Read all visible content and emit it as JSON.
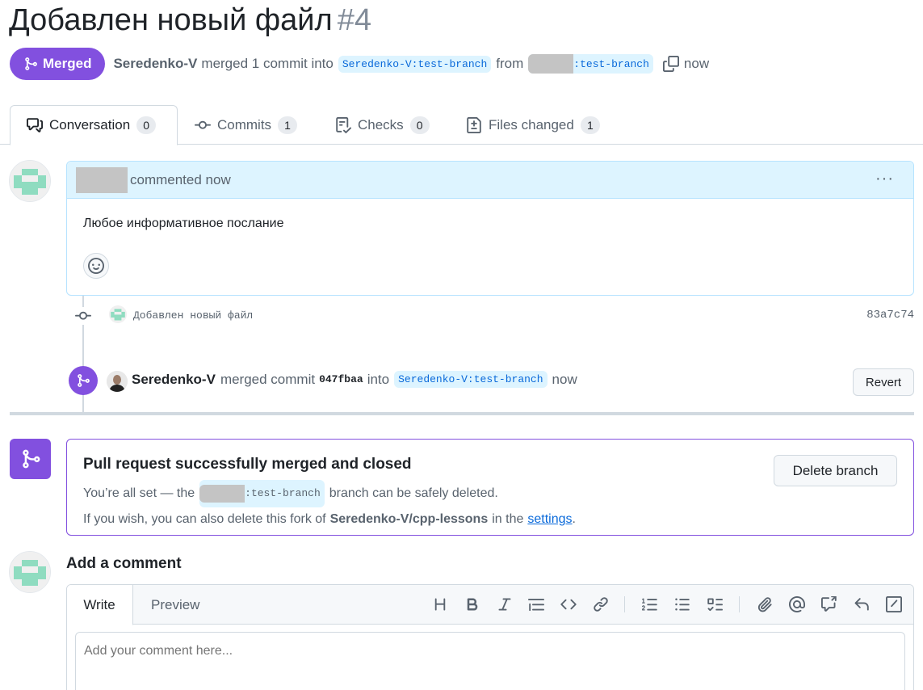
{
  "header": {
    "title": "Добавлен новый файл",
    "number": "#4",
    "state_label": "Merged",
    "author": "Seredenko-V",
    "merge_text": "merged 1 commit into",
    "base_branch": "Seredenko-V:test-branch",
    "from_text": "from",
    "head_branch_suffix": ":test-branch",
    "time": "now"
  },
  "tabs": [
    {
      "label": "Conversation",
      "count": "0"
    },
    {
      "label": "Commits",
      "count": "1"
    },
    {
      "label": "Checks",
      "count": "0"
    },
    {
      "label": "Files changed",
      "count": "1"
    }
  ],
  "comment": {
    "action": "commented now",
    "body": "Любое информативное послание",
    "menu": "···"
  },
  "commit": {
    "message": "Добавлен новый файл",
    "sha": "83a7c74"
  },
  "merge_event": {
    "author": "Seredenko-V",
    "text1": "merged commit",
    "sha": "047fbaa",
    "text2": "into",
    "branch": "Seredenko-V:test-branch",
    "time": "now",
    "revert_label": "Revert"
  },
  "merged_box": {
    "heading": "Pull request successfully merged and closed",
    "line1_pre": "You’re all set — the",
    "branch_suffix": ":test-branch",
    "line1_post": "branch can be safely deleted.",
    "line2_pre": "If you wish, you can also delete this fork of",
    "repo": "Seredenko-V/cpp-lessons",
    "line2_mid": "in the",
    "settings_link": "settings",
    "line2_end": ".",
    "delete_label": "Delete branch"
  },
  "add_comment": {
    "title": "Add a comment",
    "write_tab": "Write",
    "preview_tab": "Preview",
    "placeholder": "Add your comment here..."
  },
  "toolbar_icons": [
    "heading-icon",
    "bold-icon",
    "italic-icon",
    "quote-icon",
    "code-icon",
    "link-icon",
    "ordered-list-icon",
    "unordered-list-icon",
    "task-list-icon",
    "attach-icon",
    "mention-icon",
    "reference-icon",
    "reply-icon",
    "slash-command-icon"
  ],
  "colors": {
    "merged_purple": "#8250df",
    "branch_bg": "#ddf4ff",
    "branch_fg": "#0969da",
    "comment_header_bg": "#ddf4ff",
    "identicon": "#8fdcc0"
  }
}
